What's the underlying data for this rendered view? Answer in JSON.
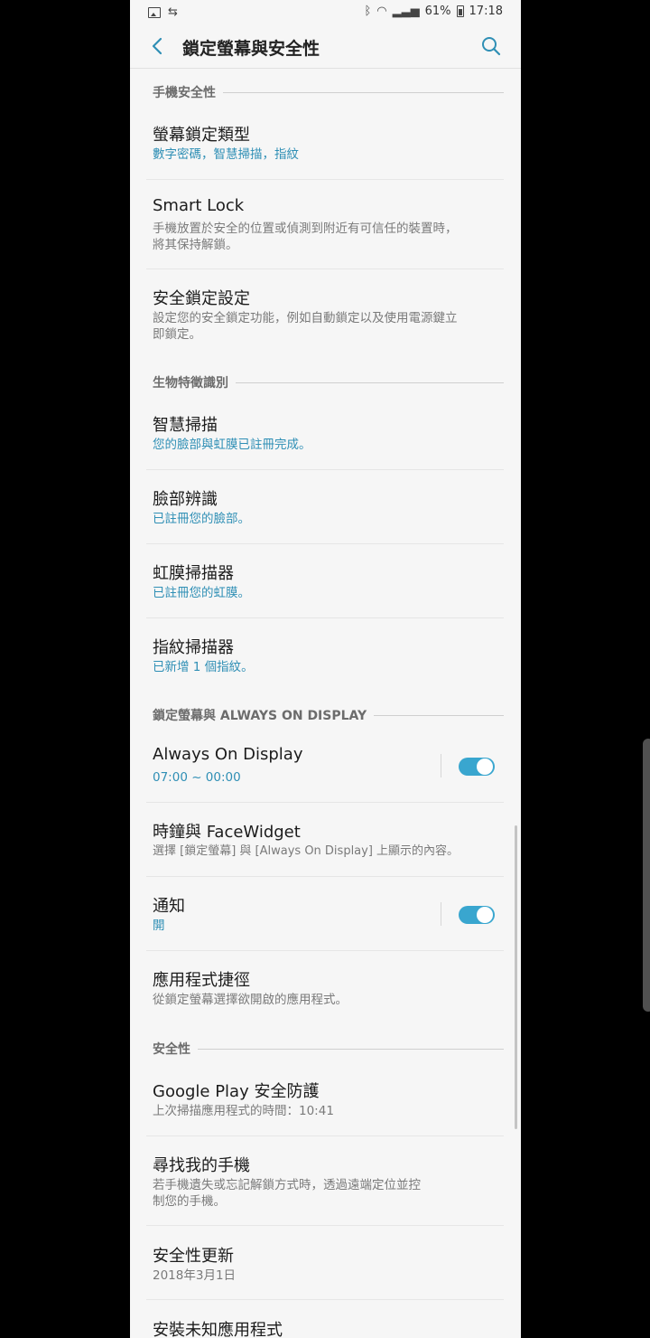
{
  "status_bar": {
    "left_icons": [
      "picture-icon",
      "sync-icon"
    ],
    "battery": "61%",
    "time": "17:18"
  },
  "header": {
    "title": "鎖定螢幕與安全性"
  },
  "sections": {
    "phone_security": "手機安全性",
    "biometrics": "生物特徵識別",
    "lockscreen_aod": "鎖定螢幕與 ALWAYS ON DISPLAY",
    "security": "安全性"
  },
  "items": {
    "screen_lock_type": {
      "title": "螢幕鎖定類型",
      "sub": "數字密碼，智慧掃描，指紋"
    },
    "smart_lock": {
      "title": "Smart Lock",
      "sub": "手機放置於安全的位置或偵測到附近有可信任的裝置時，將其保持解鎖。"
    },
    "secure_lock": {
      "title": "安全鎖定設定",
      "sub": "設定您的安全鎖定功能，例如自動鎖定以及使用電源鍵立即鎖定。"
    },
    "intelligent_scan": {
      "title": "智慧掃描",
      "sub": "您的臉部與虹膜已註冊完成。"
    },
    "face_recognition": {
      "title": "臉部辨識",
      "sub": "已註冊您的臉部。"
    },
    "iris_scanner": {
      "title": "虹膜掃描器",
      "sub": "已註冊您的虹膜。"
    },
    "fingerprint_scanner": {
      "title": "指紋掃描器",
      "sub": "已新增 1 個指紋。"
    },
    "always_on_display": {
      "title": "Always On Display",
      "sub": "07:00 ~ 00:00",
      "enabled": true
    },
    "clock_facewidget": {
      "title": "時鐘與 FaceWidget",
      "sub": "選擇 [鎖定螢幕] 與 [Always On Display] 上顯示的內容。"
    },
    "notifications": {
      "title": "通知",
      "sub": "開",
      "enabled": true
    },
    "app_shortcuts": {
      "title": "應用程式捷徑",
      "sub": "從鎖定螢幕選擇欲開啟的應用程式。"
    },
    "google_play_protect": {
      "title": "Google Play 安全防護",
      "sub": "上次掃描應用程式的時間：10:41"
    },
    "find_my_mobile": {
      "title": "尋找我的手機",
      "sub": "若手機遺失或忘記解鎖方式時，透過遠端定位並控制您的手機。"
    },
    "security_update": {
      "title": "安全性更新",
      "sub": "2018年3月1日"
    },
    "unknown_apps": {
      "title": "安裝未知應用程式"
    }
  },
  "colors": {
    "accent": "#2f8fb5",
    "toggle_on": "#39a6cf",
    "background": "#f6f6f6"
  }
}
